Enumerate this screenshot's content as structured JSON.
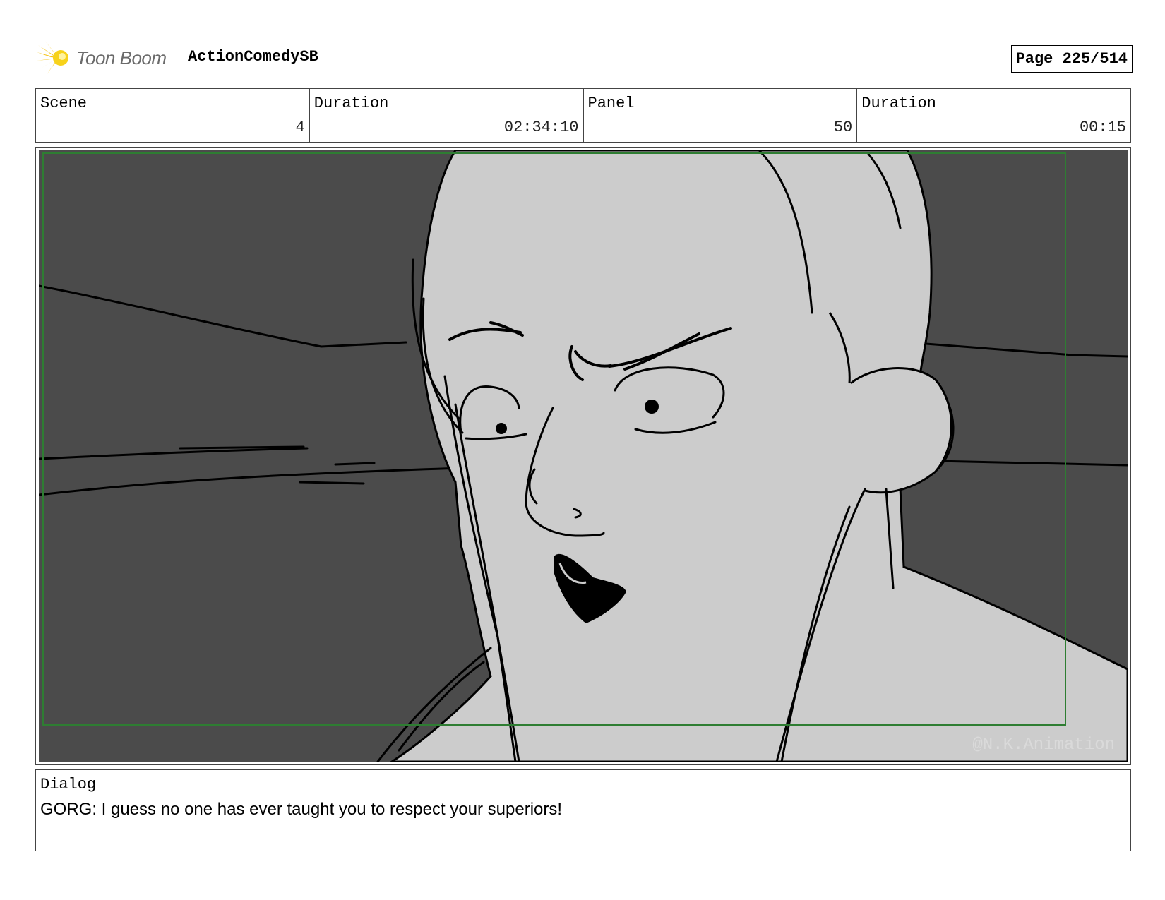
{
  "header": {
    "brand": "Toon Boom",
    "project": "ActionComedySB",
    "page": "Page 225/514"
  },
  "info": {
    "scene_label": "Scene",
    "scene_value": "4",
    "scene_duration_label": "Duration",
    "scene_duration_value": "02:34:10",
    "panel_label": "Panel",
    "panel_value": "50",
    "panel_duration_label": "Duration",
    "panel_duration_value": "00:15"
  },
  "panel": {
    "watermark": "@N.K.Animation",
    "colors": {
      "background": "#4b4b4b",
      "skin": "#cccccc",
      "frame_guide": "#2e7d32",
      "ink": "#000000"
    }
  },
  "dialog": {
    "label": "Dialog",
    "text": "GORG: I guess no one has ever taught you to respect your superiors!"
  }
}
